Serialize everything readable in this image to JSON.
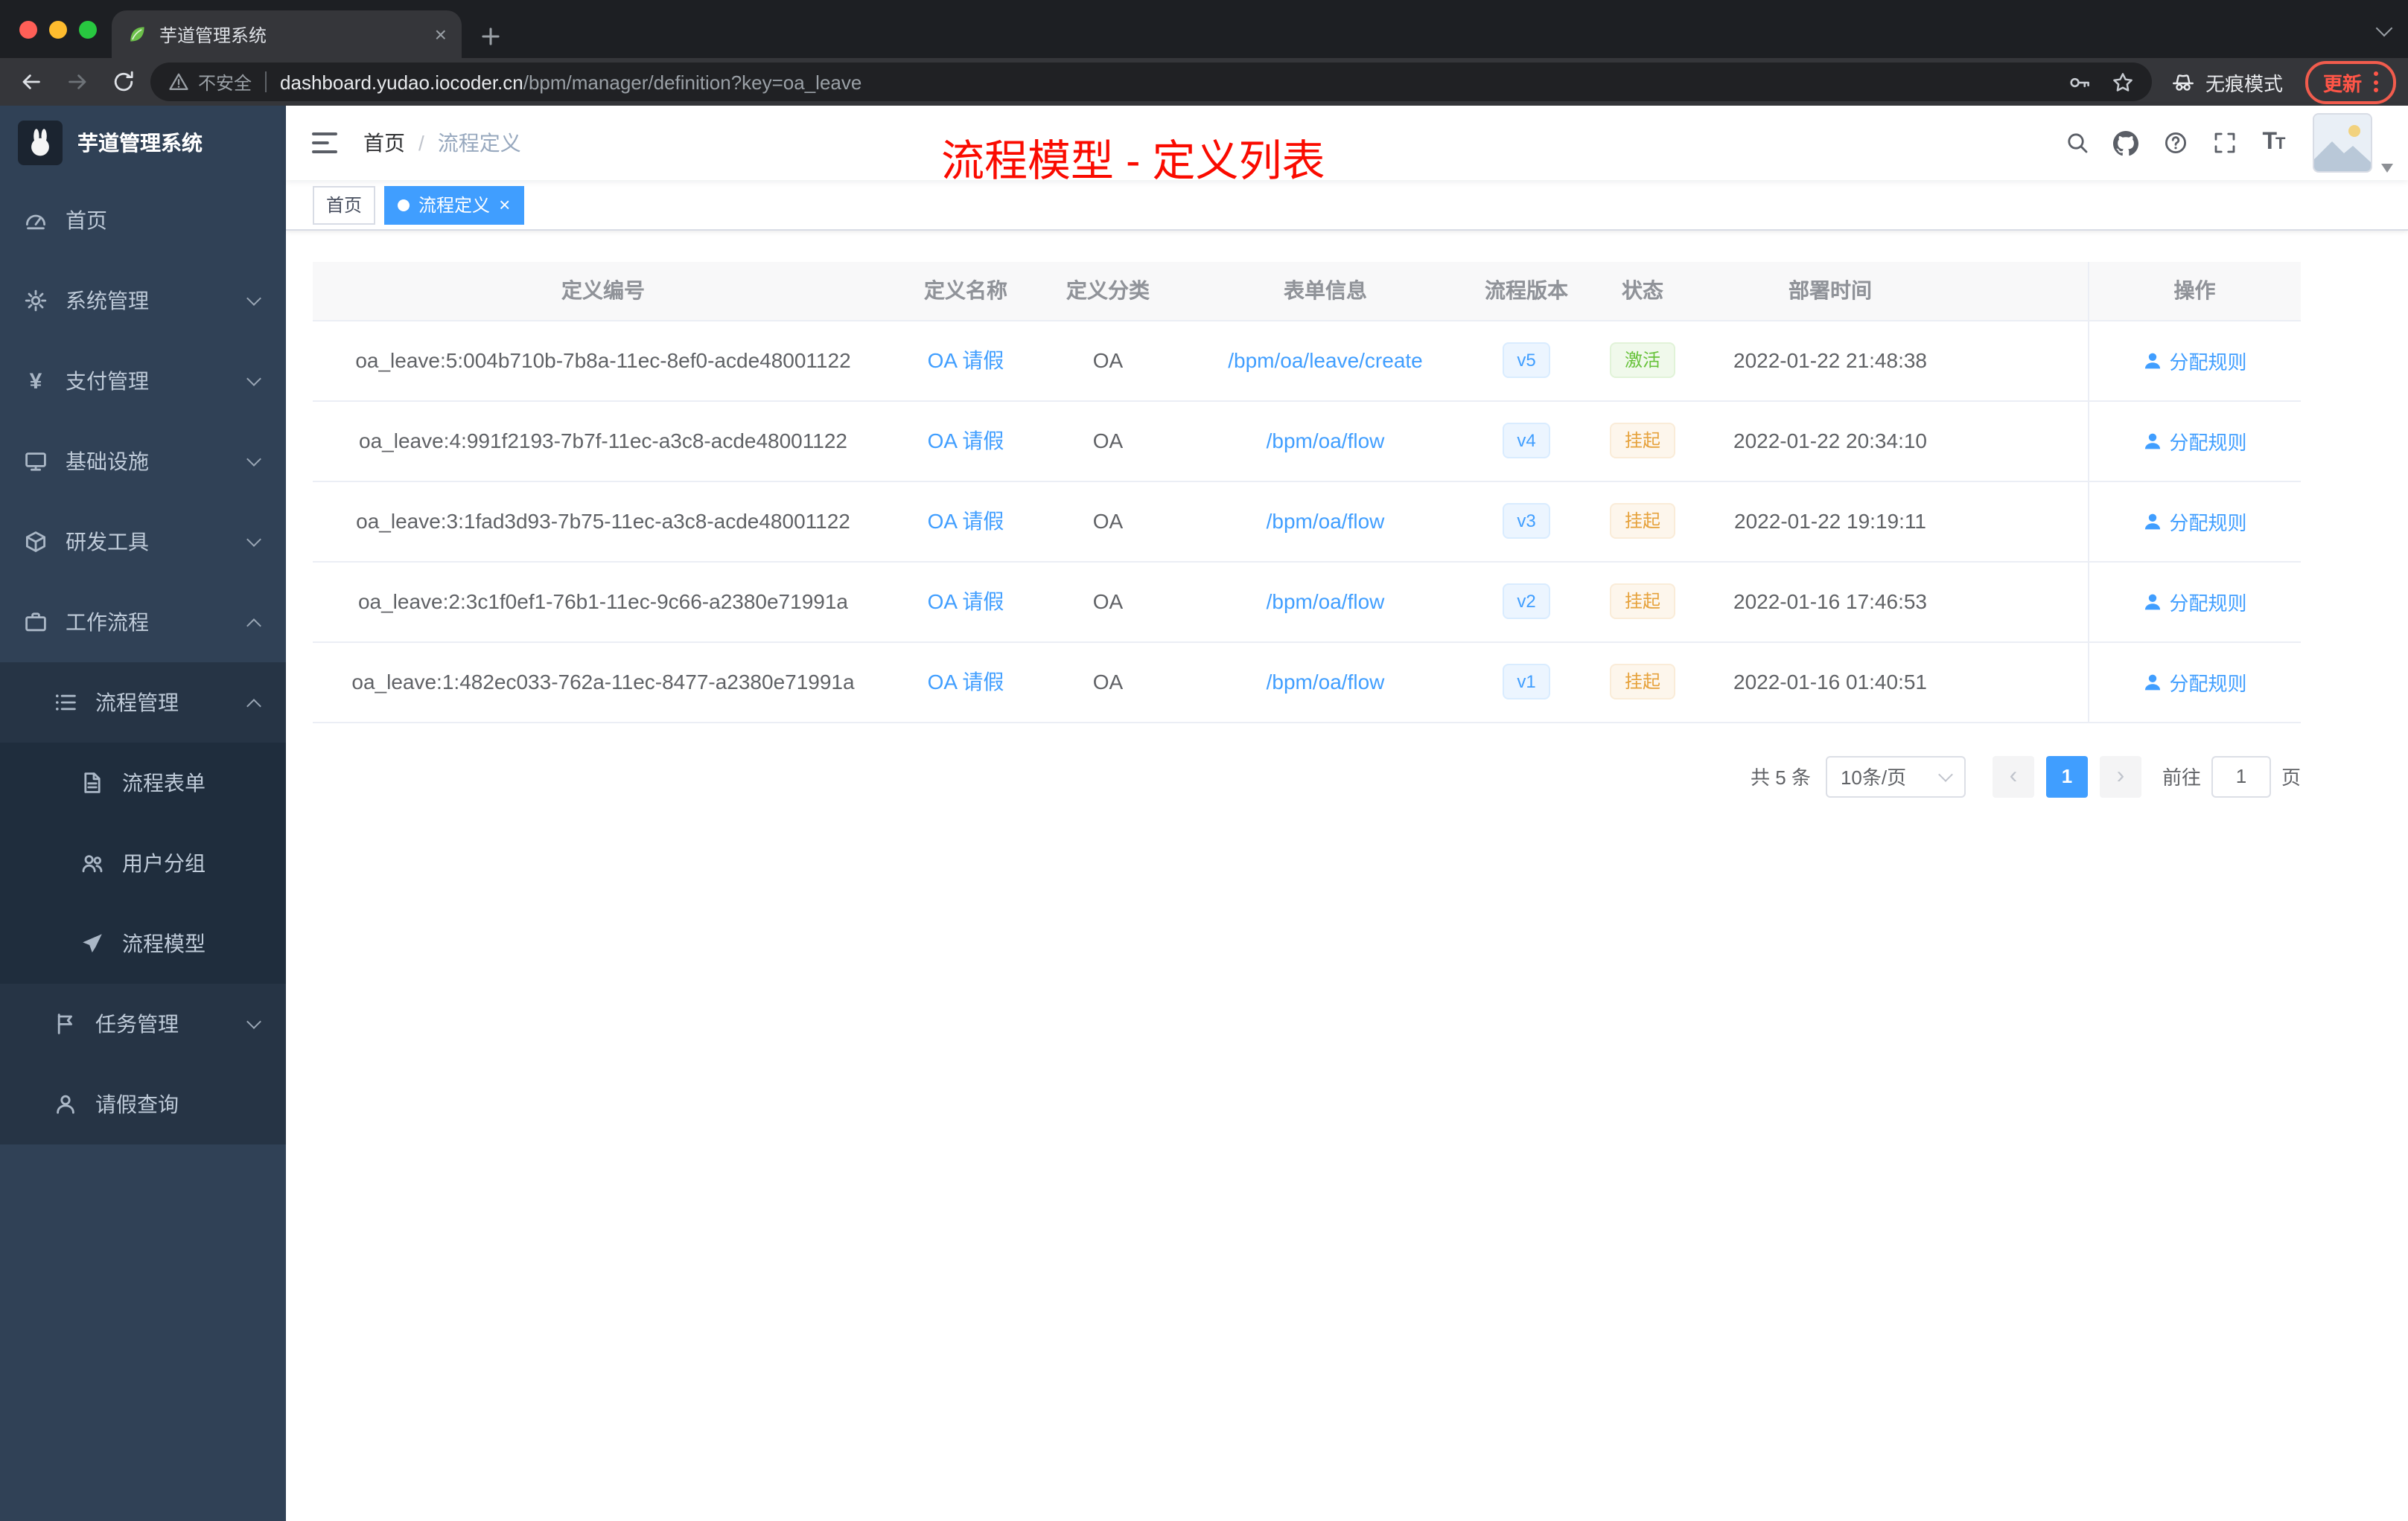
{
  "browser": {
    "tab": {
      "title": "芋道管理系统"
    },
    "url": {
      "security": "不安全",
      "domain": "dashboard.yudao.iocoder.cn",
      "path": "/bpm/manager/definition?key=oa_leave"
    },
    "incognito_label": "无痕模式",
    "update_label": "更新"
  },
  "sidebar": {
    "logo_title": "芋道管理系统",
    "items": [
      {
        "key": "home",
        "label": "首页",
        "icon": "dashboard-icon",
        "level": 1
      },
      {
        "key": "system",
        "label": "系统管理",
        "icon": "gear-icon",
        "level": 1,
        "chevron": "down"
      },
      {
        "key": "payment",
        "label": "支付管理",
        "icon": "yen-icon",
        "level": 1,
        "chevron": "down"
      },
      {
        "key": "infra",
        "label": "基础设施",
        "icon": "infra-icon",
        "level": 1,
        "chevron": "down"
      },
      {
        "key": "devtools",
        "label": "研发工具",
        "icon": "tools-icon",
        "level": 1,
        "chevron": "down"
      },
      {
        "key": "workflow",
        "label": "工作流程",
        "icon": "workflow-icon",
        "level": 1,
        "chevron": "up"
      },
      {
        "key": "process-manage",
        "label": "流程管理",
        "icon": "process-icon",
        "level": 2,
        "chevron": "up"
      },
      {
        "key": "process-form",
        "label": "流程表单",
        "icon": "form-icon",
        "level": 3
      },
      {
        "key": "user-group",
        "label": "用户分组",
        "icon": "group-icon",
        "level": 3
      },
      {
        "key": "process-model",
        "label": "流程模型",
        "icon": "model-icon",
        "level": 3
      },
      {
        "key": "task-manage",
        "label": "任务管理",
        "icon": "task-icon",
        "level": 2,
        "chevron": "down"
      },
      {
        "key": "leave-query",
        "label": "请假查询",
        "icon": "person-icon",
        "level": 2
      }
    ]
  },
  "header": {
    "breadcrumb": [
      "首页",
      "流程定义"
    ],
    "annotation": "流程模型 - 定义列表"
  },
  "tags": [
    {
      "label": "首页",
      "active": false
    },
    {
      "label": "流程定义",
      "active": true
    }
  ],
  "table": {
    "columns": [
      "定义编号",
      "定义名称",
      "定义分类",
      "表单信息",
      "流程版本",
      "状态",
      "部署时间",
      "操作"
    ],
    "action_label": "分配规则",
    "rows": [
      {
        "id": "oa_leave:5:004b710b-7b8a-11ec-8ef0-acde48001122",
        "name": "OA 请假",
        "category": "OA",
        "form": "/bpm/oa/leave/create",
        "version": "v5",
        "status": "激活",
        "status_type": "success",
        "time": "2022-01-22 21:48:38"
      },
      {
        "id": "oa_leave:4:991f2193-7b7f-11ec-a3c8-acde48001122",
        "name": "OA 请假",
        "category": "OA",
        "form": "/bpm/oa/flow",
        "version": "v4",
        "status": "挂起",
        "status_type": "warning",
        "time": "2022-01-22 20:34:10"
      },
      {
        "id": "oa_leave:3:1fad3d93-7b75-11ec-a3c8-acde48001122",
        "name": "OA 请假",
        "category": "OA",
        "form": "/bpm/oa/flow",
        "version": "v3",
        "status": "挂起",
        "status_type": "warning",
        "time": "2022-01-22 19:19:11"
      },
      {
        "id": "oa_leave:2:3c1f0ef1-76b1-11ec-9c66-a2380e71991a",
        "name": "OA 请假",
        "category": "OA",
        "form": "/bpm/oa/flow",
        "version": "v2",
        "status": "挂起",
        "status_type": "warning",
        "time": "2022-01-16 17:46:53"
      },
      {
        "id": "oa_leave:1:482ec033-762a-11ec-8477-a2380e71991a",
        "name": "OA 请假",
        "category": "OA",
        "form": "/bpm/oa/flow",
        "version": "v1",
        "status": "挂起",
        "status_type": "warning",
        "time": "2022-01-16 01:40:51"
      }
    ]
  },
  "pagination": {
    "total_text": "共 5 条",
    "page_size": "10条/页",
    "current_page": "1",
    "goto_prefix": "前往",
    "goto_value": "1",
    "goto_suffix": "页",
    "accent_color": "#409eff"
  },
  "colors": {
    "sidebar_bg": "#304156",
    "accent": "#409eff",
    "annotation_red": "#fa0b00",
    "success_green": "#67c23a",
    "warning_orange": "#e6a23c"
  }
}
